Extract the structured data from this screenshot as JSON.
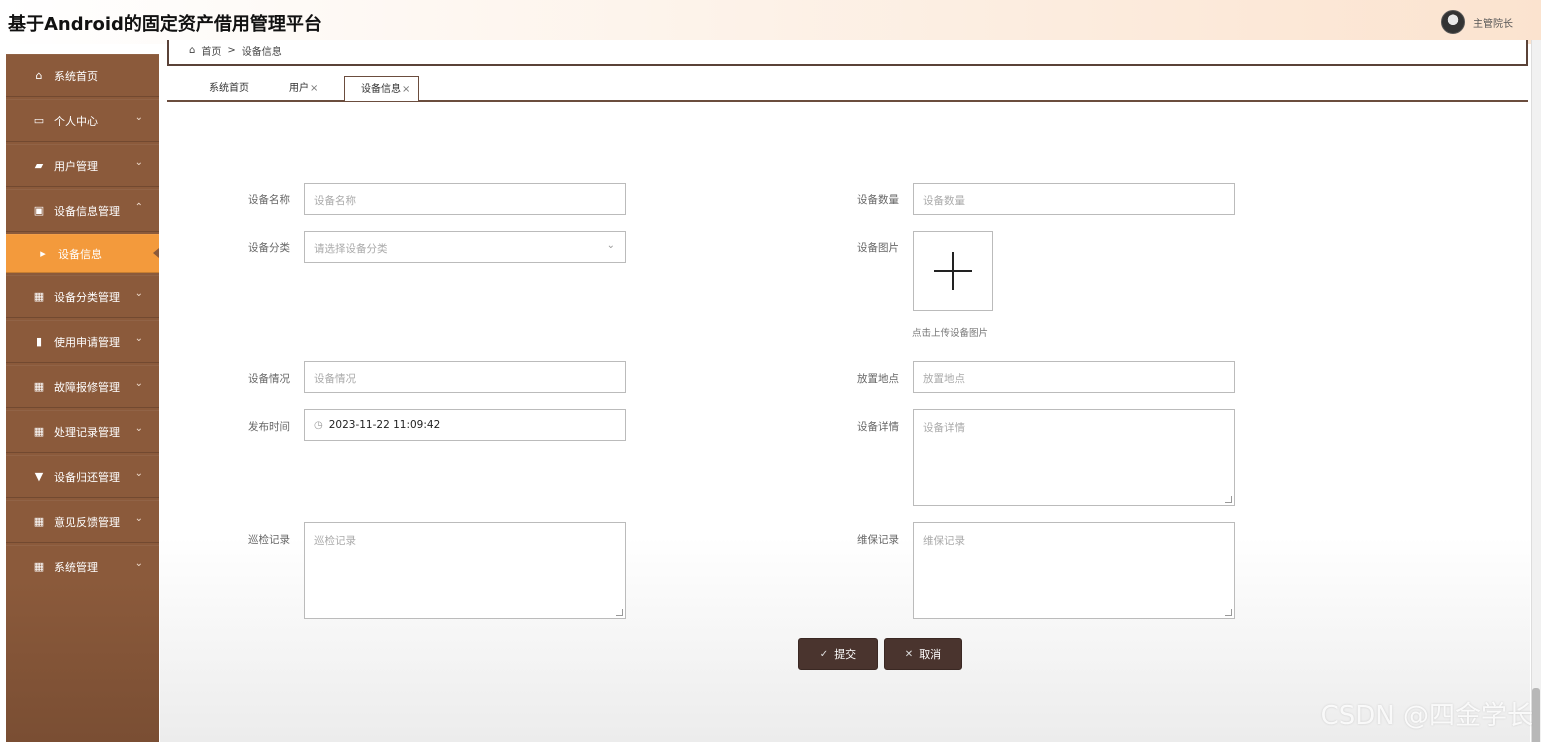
{
  "app": {
    "title": "基于Android的固定资产借用管理平台"
  },
  "user": {
    "name": "主管院长"
  },
  "breadcrumb": {
    "home": "首页",
    "separator": ">",
    "current": "设备信息",
    "home_icon": "home-icon"
  },
  "tabs": [
    {
      "label": "系统首页",
      "close": ""
    },
    {
      "label": "用户",
      "close": "×"
    },
    {
      "label": "设备信息",
      "close": "×"
    }
  ],
  "sidebar": {
    "items": [
      {
        "label": "系统首页",
        "icon": "home-icon",
        "glyph": "⌂"
      },
      {
        "label": "个人中心",
        "icon": "card-icon",
        "glyph": "▭",
        "chevron": "⌄"
      },
      {
        "label": "用户管理",
        "icon": "monitor-icon",
        "glyph": "▰",
        "chevron": "⌄"
      },
      {
        "label": "设备信息管理",
        "icon": "clipboard-icon",
        "glyph": "▣",
        "chevron": "⌃"
      },
      {
        "label": "设备信息",
        "icon": "caret-right-icon",
        "glyph": "▸"
      },
      {
        "label": "设备分类管理",
        "icon": "grid-icon",
        "glyph": "▦",
        "chevron": "⌄"
      },
      {
        "label": "使用申请管理",
        "icon": "bar-chart-icon",
        "glyph": "▮",
        "chevron": "⌄"
      },
      {
        "label": "故障报修管理",
        "icon": "grid-icon",
        "glyph": "▦",
        "chevron": "⌄"
      },
      {
        "label": "处理记录管理",
        "icon": "grid-icon",
        "glyph": "▦",
        "chevron": "⌄"
      },
      {
        "label": "设备归还管理",
        "icon": "cup-icon",
        "glyph": "▼",
        "chevron": "⌄"
      },
      {
        "label": "意见反馈管理",
        "icon": "grid-icon",
        "glyph": "▦",
        "chevron": "⌄"
      },
      {
        "label": "系统管理",
        "icon": "grid-icon",
        "glyph": "▦",
        "chevron": "⌄"
      }
    ]
  },
  "form": {
    "device_name": {
      "label": "设备名称",
      "placeholder": "设备名称"
    },
    "device_quantity": {
      "label": "设备数量",
      "placeholder": "设备数量"
    },
    "device_category": {
      "label": "设备分类",
      "placeholder": "请选择设备分类"
    },
    "device_image": {
      "label": "设备图片",
      "hint": "点击上传设备图片"
    },
    "device_condition": {
      "label": "设备情况",
      "placeholder": "设备情况"
    },
    "location": {
      "label": "放置地点",
      "placeholder": "放置地点"
    },
    "publish_time": {
      "label": "发布时间",
      "value": "2023-11-22 11:09:42"
    },
    "device_details": {
      "label": "设备详情",
      "placeholder": "设备详情"
    },
    "inspection_record": {
      "label": "巡检记录",
      "placeholder": "巡检记录"
    },
    "maintenance_record": {
      "label": "维保记录",
      "placeholder": "维保记录"
    }
  },
  "buttons": {
    "submit": "提交",
    "cancel": "取消"
  },
  "watermark": "CSDN @四金学长",
  "colors": {
    "sidebar": "#8b5a3b",
    "active": "#f39a3c",
    "button": "#4a342e"
  }
}
